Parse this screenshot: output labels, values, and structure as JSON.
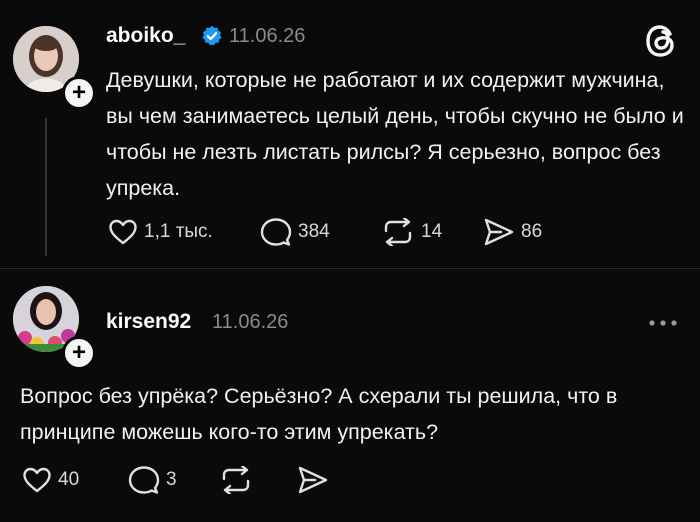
{
  "post1": {
    "username": "aboiko_",
    "date": "11.06.26",
    "text": "Девушки, которые не работают и их содержит мужчина, вы чем занимаетесь целый день, чтобы скучно не было и чтобы не лезть листать рилсы? Я серьезно, вопрос без упрека.",
    "likes": "1,1 тыс.",
    "replies": "384",
    "reposts": "14",
    "shares": "86",
    "verified_color": "#1d9bf0"
  },
  "post2": {
    "username": "kirsen92",
    "date": "11.06.26",
    "text": "Вопрос без упрёка? Серьёзно? А схерали ты решила, что в принципе можешь кого-то этим упрекать?",
    "likes": "40",
    "replies": "3"
  },
  "icons": {
    "follow": "plus-icon",
    "like": "heart-icon",
    "reply": "comment-icon",
    "repost": "repost-icon",
    "share": "send-icon",
    "app": "threads-logo-icon",
    "more": "more-icon"
  }
}
